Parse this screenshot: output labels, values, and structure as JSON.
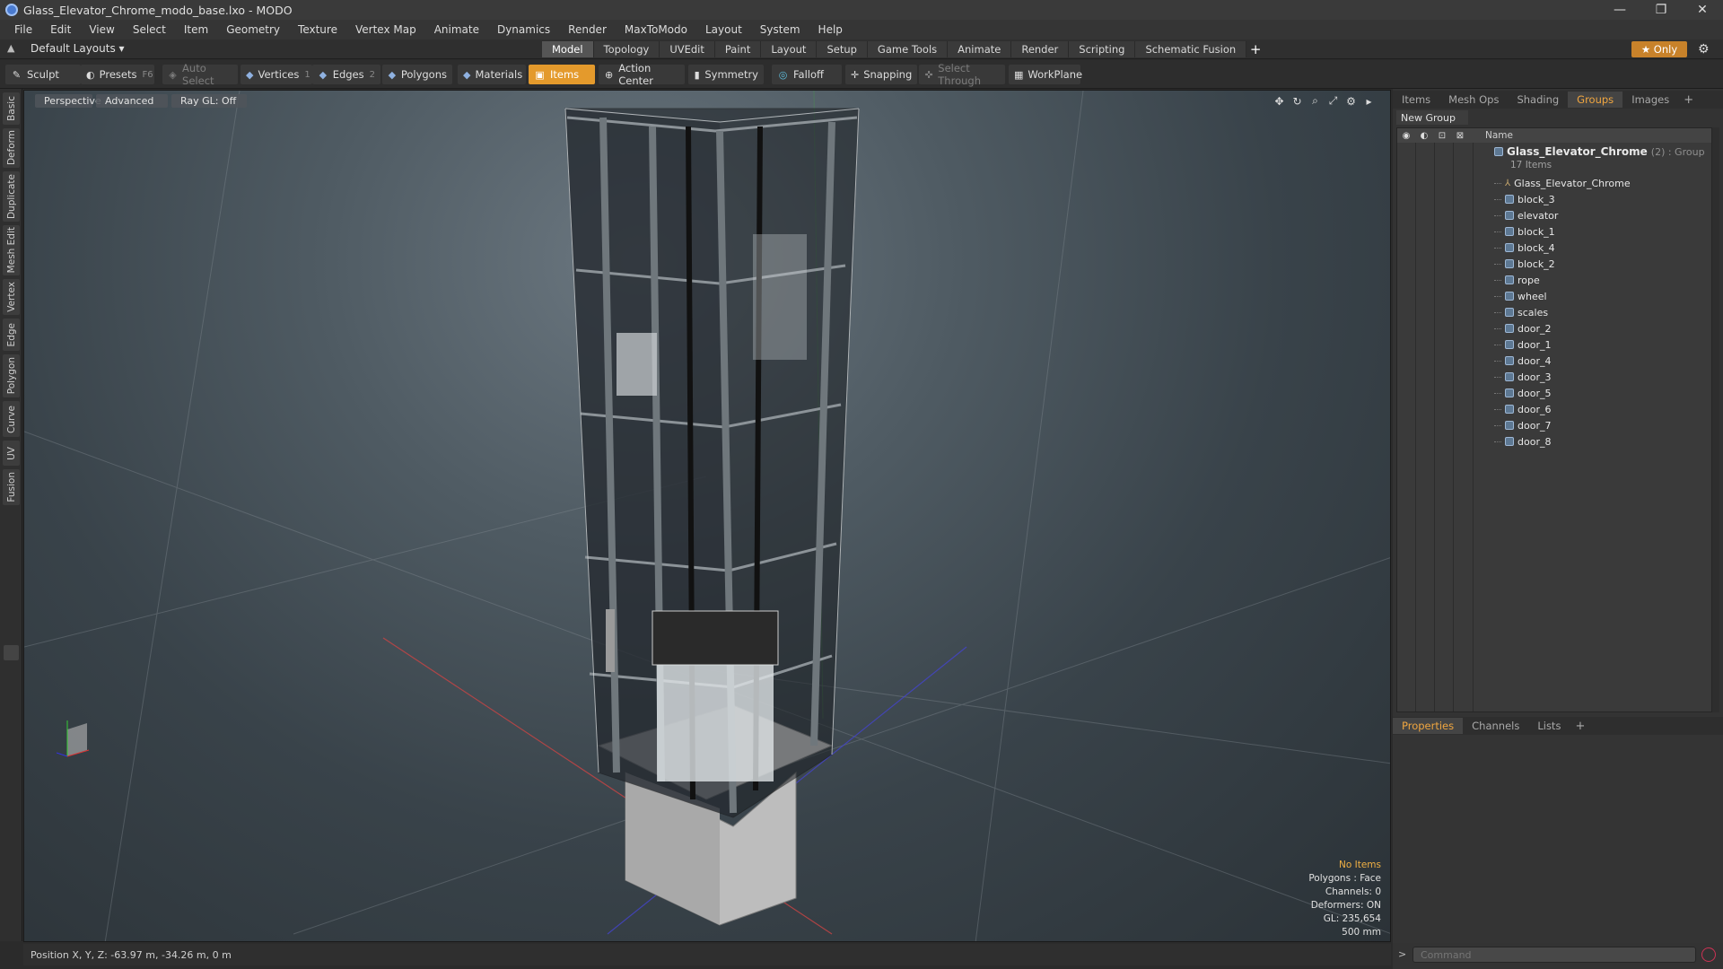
{
  "window": {
    "title": "Glass_Elevator_Chrome_modo_base.lxo - MODO",
    "controls": [
      "—",
      "❐",
      "✕"
    ]
  },
  "menu": [
    "File",
    "Edit",
    "View",
    "Select",
    "Item",
    "Geometry",
    "Texture",
    "Vertex Map",
    "Animate",
    "Dynamics",
    "Render",
    "MaxToModo",
    "Layout",
    "System",
    "Help"
  ],
  "layouts": {
    "label": "Default Layouts ▾"
  },
  "tabs": [
    {
      "label": "Model",
      "active": true
    },
    {
      "label": "Topology"
    },
    {
      "label": "UVEdit"
    },
    {
      "label": "Paint"
    },
    {
      "label": "Layout"
    },
    {
      "label": "Setup"
    },
    {
      "label": "Game Tools"
    },
    {
      "label": "Animate"
    },
    {
      "label": "Render"
    },
    {
      "label": "Scripting"
    },
    {
      "label": "Schematic Fusion"
    }
  ],
  "only_label": "★  Only",
  "toolbar": {
    "sculpt": "Sculpt",
    "presets": "Presets",
    "presets_key": "F6",
    "auto_select": "Auto Select",
    "vertices": "Vertices",
    "vertices_count": "1",
    "edges": "Edges",
    "edges_count": "2",
    "polygons": "Polygons",
    "materials": "Materials",
    "items": "Items",
    "action_center": "Action Center",
    "symmetry": "Symmetry",
    "falloff": "Falloff",
    "snapping": "Snapping",
    "select_through": "Select Through",
    "workplane": "WorkPlane"
  },
  "left_tabs": [
    "Basic",
    "Deform",
    "Duplicate",
    "Mesh Edit",
    "Vertex",
    "Edge",
    "Polygon",
    "Curve",
    "UV",
    "Fusion"
  ],
  "viewport": {
    "perspective": "Perspective",
    "advanced": "Advanced",
    "raygl": "Ray GL: Off",
    "info": {
      "no_items": "No Items",
      "polygons": "Polygons : Face",
      "channels": "Channels: 0",
      "deformers": "Deformers: ON",
      "gl": "GL: 235,654",
      "scale": "500 mm"
    }
  },
  "status": {
    "position": "Position X, Y, Z:  -63.97 m, -34.26 m, 0 m"
  },
  "right_tabs": [
    "Items",
    "Mesh Ops",
    "Shading",
    "Groups",
    "Images"
  ],
  "right_active": "Groups",
  "groups": {
    "new_group": "New Group",
    "name_header": "Name",
    "group_name": "Glass_Elevator_Chrome",
    "group_meta": "(2) : Group",
    "group_count": "17 Items",
    "items": [
      "Glass_Elevator_Chrome",
      "block_3",
      "elevator",
      "block_1",
      "block_4",
      "block_2",
      "rope",
      "wheel",
      "scales",
      "door_2",
      "door_1",
      "door_4",
      "door_3",
      "door_5",
      "door_6",
      "door_7",
      "door_8"
    ]
  },
  "prop_tabs": [
    "Properties",
    "Channels",
    "Lists"
  ],
  "command": {
    "placeholder": "Command"
  }
}
